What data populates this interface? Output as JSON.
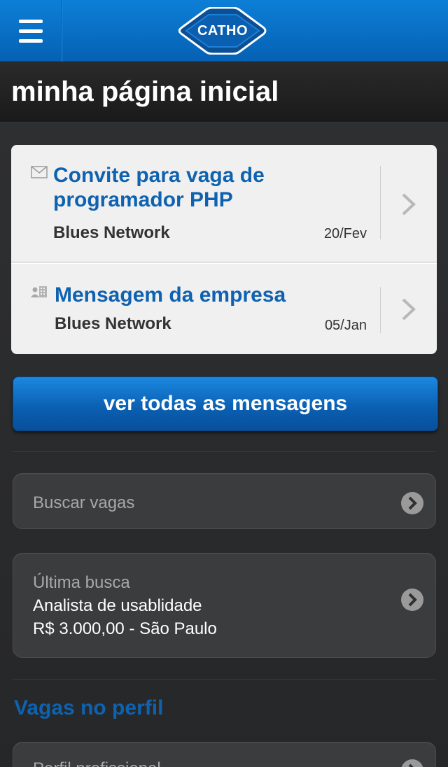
{
  "header": {
    "logo_text": "CATHO",
    "menu_icon": "hamburger-menu-icon"
  },
  "page_title": "minha página inicial",
  "messages": [
    {
      "icon": "envelope-icon",
      "title": "Convite para vaga de programador PHP",
      "company": "Blues Network",
      "date": "20/Fev"
    },
    {
      "icon": "company-building-icon",
      "title": "Mensagem da empresa",
      "company": "Blues Network",
      "date": "05/Jan"
    }
  ],
  "view_all_button": "ver todas as mensagens",
  "search_jobs": {
    "label": "Buscar vagas"
  },
  "last_search": {
    "label": "Última busca",
    "query": "Analista de usablidade",
    "details": "R$ 3.000,00 - São Paulo"
  },
  "profile_section": {
    "title": "Vagas no perfil",
    "first_item_label": "Perfil profissional"
  },
  "colors": {
    "brand_blue": "#0561b4",
    "link_blue": "#0e62b0",
    "background": "#2a2b2d"
  }
}
